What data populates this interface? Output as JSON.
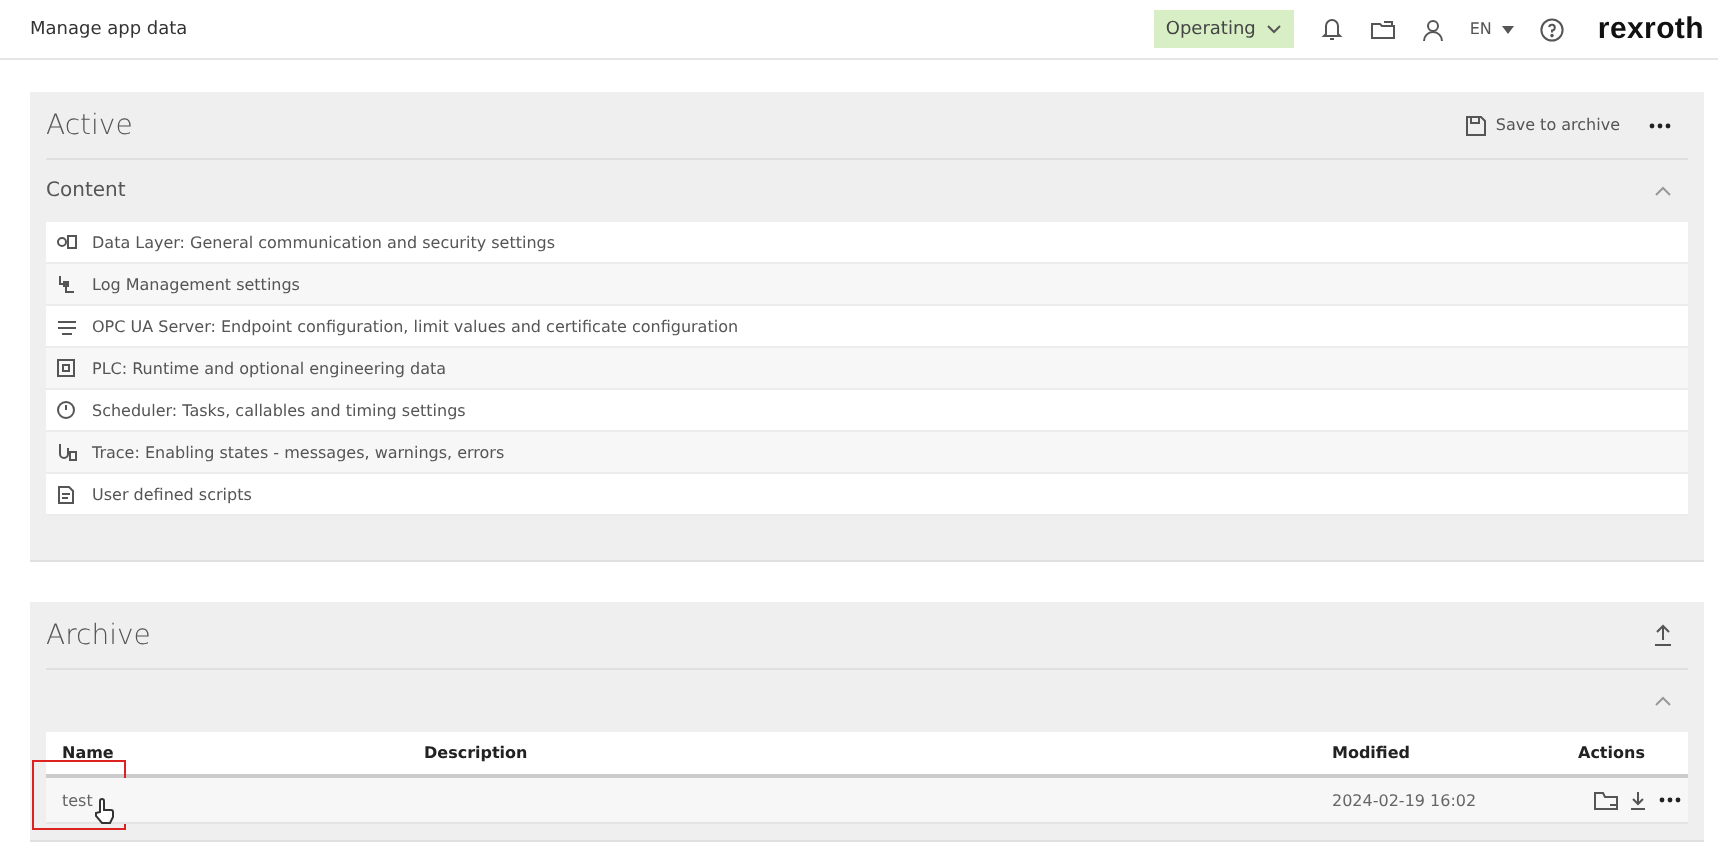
{
  "header": {
    "title": "Manage app data",
    "state_button": "Operating",
    "language": "EN",
    "logo": "rexroth"
  },
  "active": {
    "title": "Active",
    "save_button": "Save to archive",
    "content": {
      "title": "Content",
      "expanded": true,
      "items": [
        {
          "label": "Data Layer: General communication and security settings"
        },
        {
          "label": "Log Management settings"
        },
        {
          "label": "OPC UA Server: Endpoint configuration, limit values and certificate configuration"
        },
        {
          "label": "PLC: Runtime and optional engineering data"
        },
        {
          "label": "Scheduler: Tasks, callables and timing settings"
        },
        {
          "label": "Trace: Enabling states - messages, warnings, errors"
        },
        {
          "label": "User defined scripts"
        }
      ]
    }
  },
  "archive": {
    "title": "Archive",
    "expanded": true,
    "table": {
      "columns": [
        "Name",
        "Description",
        "Modified",
        "Actions"
      ],
      "rows": [
        {
          "name": "test",
          "description": "",
          "modified": "2024-02-19 16:02",
          "highlighted": true
        }
      ]
    }
  }
}
